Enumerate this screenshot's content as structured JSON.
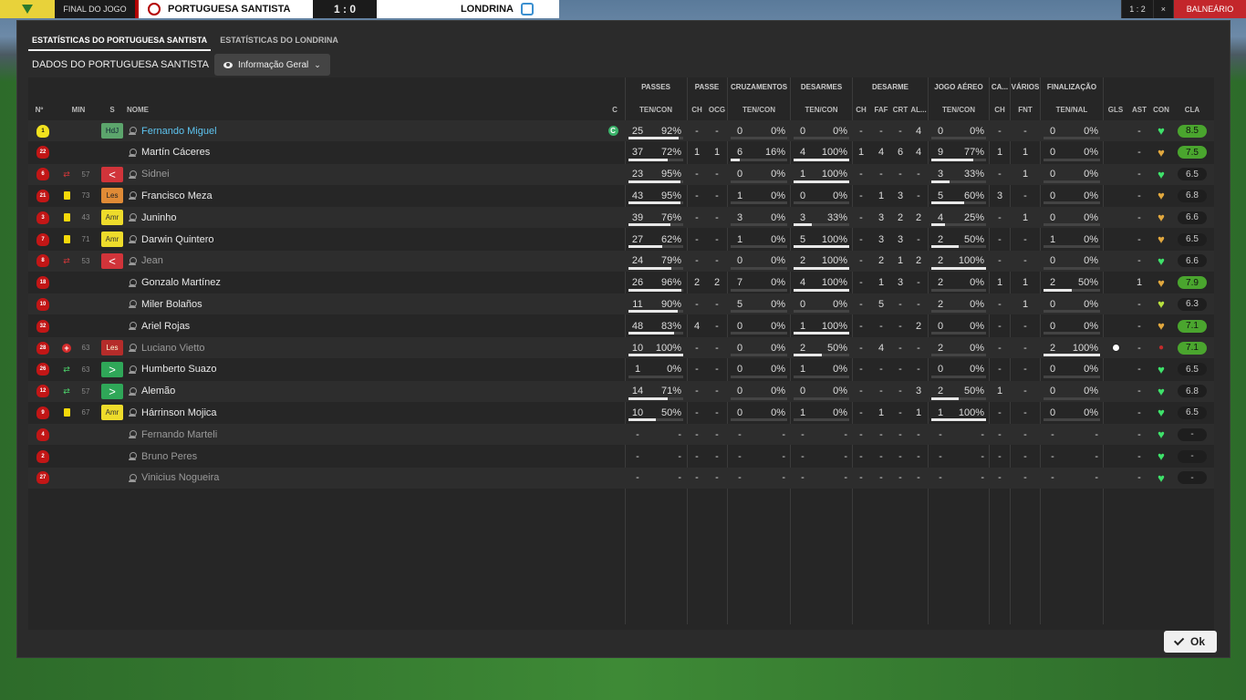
{
  "scoreboard": {
    "status": "FINAL DO JOGO",
    "home": "PORTUGUESA SANTISTA",
    "score": "1 : 0",
    "away": "LONDRINA",
    "right_buttons": [
      "1 : 2",
      "×"
    ],
    "exit_label": "BALNEÁRIO"
  },
  "tabs": [
    {
      "label": "ESTATÍSTICAS DO PORTUGUESA SANTISTA",
      "active": true
    },
    {
      "label": "ESTATÍSTICAS DO LONDRINA",
      "active": false
    }
  ],
  "subheader": {
    "title": "DADOS DO PORTUGUESA SANTISTA",
    "view_dropdown": "Informação Geral"
  },
  "groups": [
    "PASSES",
    "PASSE",
    "CRUZAMENTOS",
    "DESARMES",
    "DESARME",
    "JOGO AÉREO",
    "CA...",
    "VÁRIOS",
    "FINALIZAÇÃO"
  ],
  "columns": {
    "no": "Nº",
    "min": "MIN",
    "s": "S",
    "name": "NOME",
    "c": "C",
    "passes": "TEN/CON",
    "passe_ch": "CH",
    "passe_ocg": "OCG",
    "cruz": "TEN/CON",
    "desarmes": "TEN/CON",
    "des_ch": "CH",
    "des_faf": "FAF",
    "des_crt": "CRT",
    "des_al": "AL...",
    "aereo": "TEN/CON",
    "ca_ch": "CH",
    "var_fnt": "FNT",
    "fin": "TEN/NAL",
    "gls": "GLS",
    "ast": "AST",
    "con": "CON",
    "cla": "CLA"
  },
  "players": [
    {
      "no": "1",
      "gk": true,
      "event": "",
      "min": "",
      "pos": "HdJ",
      "pos_style": "gk",
      "name": "Fernando Miguel",
      "link": true,
      "captain": true,
      "p_t": "25",
      "p_p": "92%",
      "p_f": 0.92,
      "ch": "-",
      "ocg": "-",
      "cr_t": "0",
      "cr_p": "0%",
      "cr_f": 0,
      "de_t": "0",
      "de_p": "0%",
      "de_f": 0,
      "dch": "-",
      "faf": "-",
      "crt": "-",
      "al": "4",
      "ae_t": "0",
      "ae_p": "0%",
      "ae_f": 0,
      "ca": "-",
      "fnt": "-",
      "fi_t": "0",
      "fi_p": "0%",
      "fi_f": 0,
      "gls": "",
      "ast": "-",
      "con": "g",
      "cla": "8.5",
      "hi": true,
      "muted": false,
      "ball": false
    },
    {
      "no": "22",
      "gk": false,
      "event": "",
      "min": "",
      "pos": "",
      "pos_style": "",
      "name": "Martín Cáceres",
      "link": false,
      "captain": false,
      "p_t": "37",
      "p_p": "72%",
      "p_f": 0.72,
      "ch": "1",
      "ocg": "1",
      "cr_t": "6",
      "cr_p": "16%",
      "cr_f": 0.16,
      "de_t": "4",
      "de_p": "100%",
      "de_f": 1,
      "dch": "1",
      "faf": "4",
      "crt": "6",
      "al": "4",
      "ae_t": "9",
      "ae_p": "77%",
      "ae_f": 0.77,
      "ca": "1",
      "fnt": "1",
      "fi_t": "0",
      "fi_p": "0%",
      "fi_f": 0,
      "gls": "",
      "ast": "-",
      "con": "y",
      "cla": "7.5",
      "hi": true,
      "muted": false,
      "ball": false
    },
    {
      "no": "6",
      "gk": false,
      "event": "off",
      "min": "57",
      "pos": "<",
      "pos_style": "out",
      "name": "Sidnei",
      "link": false,
      "captain": false,
      "p_t": "23",
      "p_p": "95%",
      "p_f": 0.95,
      "ch": "-",
      "ocg": "-",
      "cr_t": "0",
      "cr_p": "0%",
      "cr_f": 0,
      "de_t": "1",
      "de_p": "100%",
      "de_f": 1,
      "dch": "-",
      "faf": "-",
      "crt": "-",
      "al": "-",
      "ae_t": "3",
      "ae_p": "33%",
      "ae_f": 0.33,
      "ca": "-",
      "fnt": "1",
      "fi_t": "0",
      "fi_p": "0%",
      "fi_f": 0,
      "gls": "",
      "ast": "-",
      "con": "g",
      "cla": "6.5",
      "hi": false,
      "muted": true,
      "ball": false
    },
    {
      "no": "21",
      "gk": false,
      "event": "yellow",
      "min": "73",
      "pos": "Les",
      "pos_style": "les-o",
      "name": "Francisco Meza",
      "link": false,
      "captain": false,
      "p_t": "43",
      "p_p": "95%",
      "p_f": 0.95,
      "ch": "-",
      "ocg": "-",
      "cr_t": "1",
      "cr_p": "0%",
      "cr_f": 0,
      "de_t": "0",
      "de_p": "0%",
      "de_f": 0,
      "dch": "-",
      "faf": "1",
      "crt": "3",
      "al": "-",
      "ae_t": "5",
      "ae_p": "60%",
      "ae_f": 0.6,
      "ca": "3",
      "fnt": "-",
      "fi_t": "0",
      "fi_p": "0%",
      "fi_f": 0,
      "gls": "",
      "ast": "-",
      "con": "y",
      "cla": "6.8",
      "hi": false,
      "muted": false,
      "ball": false
    },
    {
      "no": "3",
      "gk": false,
      "event": "yellow",
      "min": "43",
      "pos": "Amr",
      "pos_style": "amr",
      "name": "Juninho",
      "link": false,
      "captain": false,
      "p_t": "39",
      "p_p": "76%",
      "p_f": 0.76,
      "ch": "-",
      "ocg": "-",
      "cr_t": "3",
      "cr_p": "0%",
      "cr_f": 0,
      "de_t": "3",
      "de_p": "33%",
      "de_f": 0.33,
      "dch": "-",
      "faf": "3",
      "crt": "2",
      "al": "2",
      "ae_t": "4",
      "ae_p": "25%",
      "ae_f": 0.25,
      "ca": "-",
      "fnt": "1",
      "fi_t": "0",
      "fi_p": "0%",
      "fi_f": 0,
      "gls": "",
      "ast": "-",
      "con": "y",
      "cla": "6.6",
      "hi": false,
      "muted": false,
      "ball": false
    },
    {
      "no": "7",
      "gk": false,
      "event": "yellow",
      "min": "71",
      "pos": "Amr",
      "pos_style": "amr",
      "name": "Darwin Quintero",
      "link": false,
      "captain": false,
      "p_t": "27",
      "p_p": "62%",
      "p_f": 0.62,
      "ch": "-",
      "ocg": "-",
      "cr_t": "1",
      "cr_p": "0%",
      "cr_f": 0,
      "de_t": "5",
      "de_p": "100%",
      "de_f": 1,
      "dch": "-",
      "faf": "3",
      "crt": "3",
      "al": "-",
      "ae_t": "2",
      "ae_p": "50%",
      "ae_f": 0.5,
      "ca": "-",
      "fnt": "-",
      "fi_t": "1",
      "fi_p": "0%",
      "fi_f": 0,
      "gls": "",
      "ast": "-",
      "con": "y",
      "cla": "6.5",
      "hi": false,
      "muted": false,
      "ball": false
    },
    {
      "no": "8",
      "gk": false,
      "event": "off",
      "min": "53",
      "pos": "<",
      "pos_style": "out",
      "name": "Jean",
      "link": false,
      "captain": false,
      "p_t": "24",
      "p_p": "79%",
      "p_f": 0.79,
      "ch": "-",
      "ocg": "-",
      "cr_t": "0",
      "cr_p": "0%",
      "cr_f": 0,
      "de_t": "2",
      "de_p": "100%",
      "de_f": 1,
      "dch": "-",
      "faf": "2",
      "crt": "1",
      "al": "2",
      "ae_t": "2",
      "ae_p": "100%",
      "ae_f": 1,
      "ca": "-",
      "fnt": "-",
      "fi_t": "0",
      "fi_p": "0%",
      "fi_f": 0,
      "gls": "",
      "ast": "-",
      "con": "g",
      "cla": "6.6",
      "hi": false,
      "muted": true,
      "ball": false
    },
    {
      "no": "18",
      "gk": false,
      "event": "",
      "min": "",
      "pos": "",
      "pos_style": "",
      "name": "Gonzalo Martínez",
      "link": false,
      "captain": false,
      "p_t": "26",
      "p_p": "96%",
      "p_f": 0.96,
      "ch": "2",
      "ocg": "2",
      "cr_t": "7",
      "cr_p": "0%",
      "cr_f": 0,
      "de_t": "4",
      "de_p": "100%",
      "de_f": 1,
      "dch": "-",
      "faf": "1",
      "crt": "3",
      "al": "-",
      "ae_t": "2",
      "ae_p": "0%",
      "ae_f": 0,
      "ca": "1",
      "fnt": "1",
      "fi_t": "2",
      "fi_p": "50%",
      "fi_f": 0.5,
      "gls": "",
      "ast": "1",
      "con": "y",
      "cla": "7.9",
      "hi": true,
      "muted": false,
      "ball": false
    },
    {
      "no": "10",
      "gk": false,
      "event": "",
      "min": "",
      "pos": "",
      "pos_style": "",
      "name": "Miler Bolaños",
      "link": false,
      "captain": false,
      "p_t": "11",
      "p_p": "90%",
      "p_f": 0.9,
      "ch": "-",
      "ocg": "-",
      "cr_t": "5",
      "cr_p": "0%",
      "cr_f": 0,
      "de_t": "0",
      "de_p": "0%",
      "de_f": 0,
      "dch": "-",
      "faf": "5",
      "crt": "-",
      "al": "-",
      "ae_t": "2",
      "ae_p": "0%",
      "ae_f": 0,
      "ca": "-",
      "fnt": "1",
      "fi_t": "0",
      "fi_p": "0%",
      "fi_f": 0,
      "gls": "",
      "ast": "-",
      "con": "gy",
      "cla": "6.3",
      "hi": false,
      "muted": false,
      "ball": false
    },
    {
      "no": "32",
      "gk": false,
      "event": "",
      "min": "",
      "pos": "",
      "pos_style": "",
      "name": "Ariel Rojas",
      "link": false,
      "captain": false,
      "p_t": "48",
      "p_p": "83%",
      "p_f": 0.83,
      "ch": "4",
      "ocg": "-",
      "cr_t": "0",
      "cr_p": "0%",
      "cr_f": 0,
      "de_t": "1",
      "de_p": "100%",
      "de_f": 1,
      "dch": "-",
      "faf": "-",
      "crt": "-",
      "al": "2",
      "ae_t": "0",
      "ae_p": "0%",
      "ae_f": 0,
      "ca": "-",
      "fnt": "-",
      "fi_t": "0",
      "fi_p": "0%",
      "fi_f": 0,
      "gls": "",
      "ast": "-",
      "con": "y",
      "cla": "7.1",
      "hi": true,
      "muted": false,
      "ball": false
    },
    {
      "no": "28",
      "gk": false,
      "event": "injury",
      "min": "63",
      "pos": "Les",
      "pos_style": "les",
      "name": "Luciano Vietto",
      "link": false,
      "captain": false,
      "p_t": "10",
      "p_p": "100%",
      "p_f": 1,
      "ch": "-",
      "ocg": "-",
      "cr_t": "0",
      "cr_p": "0%",
      "cr_f": 0,
      "de_t": "2",
      "de_p": "50%",
      "de_f": 0.5,
      "dch": "-",
      "faf": "4",
      "crt": "-",
      "al": "-",
      "ae_t": "2",
      "ae_p": "0%",
      "ae_f": 0,
      "ca": "-",
      "fnt": "-",
      "fi_t": "2",
      "fi_p": "100%",
      "fi_f": 1,
      "gls": "",
      "ast": "-",
      "con": "r",
      "cla": "7.1",
      "hi": true,
      "muted": true,
      "ball": true
    },
    {
      "no": "26",
      "gk": false,
      "event": "on",
      "min": "63",
      "pos": ">",
      "pos_style": "in",
      "name": "Humberto Suazo",
      "link": false,
      "captain": false,
      "p_t": "1",
      "p_p": "0%",
      "p_f": 0,
      "ch": "-",
      "ocg": "-",
      "cr_t": "0",
      "cr_p": "0%",
      "cr_f": 0,
      "de_t": "1",
      "de_p": "0%",
      "de_f": 0,
      "dch": "-",
      "faf": "-",
      "crt": "-",
      "al": "-",
      "ae_t": "0",
      "ae_p": "0%",
      "ae_f": 0,
      "ca": "-",
      "fnt": "-",
      "fi_t": "0",
      "fi_p": "0%",
      "fi_f": 0,
      "gls": "",
      "ast": "-",
      "con": "g",
      "cla": "6.5",
      "hi": false,
      "muted": false,
      "ball": false
    },
    {
      "no": "12",
      "gk": false,
      "event": "on",
      "min": "57",
      "pos": ">",
      "pos_style": "in",
      "name": "Alemão",
      "link": false,
      "captain": false,
      "p_t": "14",
      "p_p": "71%",
      "p_f": 0.71,
      "ch": "-",
      "ocg": "-",
      "cr_t": "0",
      "cr_p": "0%",
      "cr_f": 0,
      "de_t": "0",
      "de_p": "0%",
      "de_f": 0,
      "dch": "-",
      "faf": "-",
      "crt": "-",
      "al": "3",
      "ae_t": "2",
      "ae_p": "50%",
      "ae_f": 0.5,
      "ca": "1",
      "fnt": "-",
      "fi_t": "0",
      "fi_p": "0%",
      "fi_f": 0,
      "gls": "",
      "ast": "-",
      "con": "g",
      "cla": "6.8",
      "hi": false,
      "muted": false,
      "ball": false
    },
    {
      "no": "9",
      "gk": false,
      "event": "yellow",
      "min": "67",
      "pos": "Amr",
      "pos_style": "amr",
      "name": "Hárrinson Mojica",
      "link": false,
      "captain": false,
      "p_t": "10",
      "p_p": "50%",
      "p_f": 0.5,
      "ch": "-",
      "ocg": "-",
      "cr_t": "0",
      "cr_p": "0%",
      "cr_f": 0,
      "de_t": "1",
      "de_p": "0%",
      "de_f": 0,
      "dch": "-",
      "faf": "1",
      "crt": "-",
      "al": "1",
      "ae_t": "1",
      "ae_p": "100%",
      "ae_f": 1,
      "ca": "-",
      "fnt": "-",
      "fi_t": "0",
      "fi_p": "0%",
      "fi_f": 0,
      "gls": "",
      "ast": "-",
      "con": "g",
      "cla": "6.5",
      "hi": false,
      "muted": false,
      "ball": false
    },
    {
      "no": "4",
      "gk": false,
      "event": "",
      "min": "",
      "pos": "",
      "pos_style": "",
      "name": "Fernando Marteli",
      "link": false,
      "captain": false,
      "p_t": "-",
      "p_p": "-",
      "p_f": -1,
      "ch": "-",
      "ocg": "-",
      "cr_t": "-",
      "cr_p": "-",
      "cr_f": -1,
      "de_t": "-",
      "de_p": "-",
      "de_f": -1,
      "dch": "-",
      "faf": "-",
      "crt": "-",
      "al": "-",
      "ae_t": "-",
      "ae_p": "-",
      "ae_f": -1,
      "ca": "-",
      "fnt": "-",
      "fi_t": "-",
      "fi_p": "-",
      "fi_f": -1,
      "gls": "",
      "ast": "-",
      "con": "g",
      "cla": "-",
      "hi": false,
      "muted": true,
      "ball": false
    },
    {
      "no": "2",
      "gk": false,
      "event": "",
      "min": "",
      "pos": "",
      "pos_style": "",
      "name": "Bruno Peres",
      "link": false,
      "captain": false,
      "p_t": "-",
      "p_p": "-",
      "p_f": -1,
      "ch": "-",
      "ocg": "-",
      "cr_t": "-",
      "cr_p": "-",
      "cr_f": -1,
      "de_t": "-",
      "de_p": "-",
      "de_f": -1,
      "dch": "-",
      "faf": "-",
      "crt": "-",
      "al": "-",
      "ae_t": "-",
      "ae_p": "-",
      "ae_f": -1,
      "ca": "-",
      "fnt": "-",
      "fi_t": "-",
      "fi_p": "-",
      "fi_f": -1,
      "gls": "",
      "ast": "-",
      "con": "g",
      "cla": "-",
      "hi": false,
      "muted": true,
      "ball": false
    },
    {
      "no": "27",
      "gk": false,
      "event": "",
      "min": "",
      "pos": "",
      "pos_style": "",
      "name": "Vinicius Nogueira",
      "link": false,
      "captain": false,
      "p_t": "-",
      "p_p": "-",
      "p_f": -1,
      "ch": "-",
      "ocg": "-",
      "cr_t": "-",
      "cr_p": "-",
      "cr_f": -1,
      "de_t": "-",
      "de_p": "-",
      "de_f": -1,
      "dch": "-",
      "faf": "-",
      "crt": "-",
      "al": "-",
      "ae_t": "-",
      "ae_p": "-",
      "ae_f": -1,
      "ca": "-",
      "fnt": "-",
      "fi_t": "-",
      "fi_p": "-",
      "fi_f": -1,
      "gls": "",
      "ast": "-",
      "con": "g",
      "cla": "-",
      "hi": false,
      "muted": true,
      "ball": false
    }
  ],
  "ok_label": "Ok",
  "colors": {
    "accent_link": "#5ec4f0",
    "rating_high": "#4aa52e",
    "home_red": "#c21616"
  }
}
